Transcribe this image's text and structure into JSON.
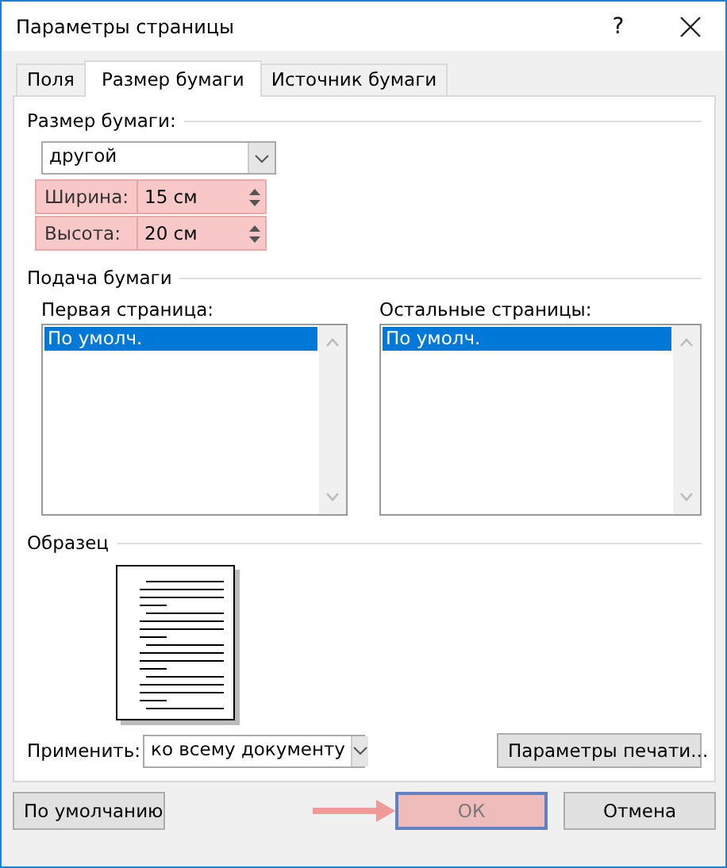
{
  "window": {
    "title": "Параметры страницы",
    "help": "?"
  },
  "tabs": [
    {
      "label": "Поля",
      "selected": false
    },
    {
      "label": "Размер бумаги",
      "selected": true
    },
    {
      "label": "Источник бумаги",
      "selected": false
    }
  ],
  "paper_size": {
    "heading": "Размер бумаги:",
    "dropdown": "другой",
    "fields": [
      {
        "label": "Ширина:",
        "value": "15 см",
        "highlighted": true
      },
      {
        "label": "Высота:",
        "value": "20 см",
        "highlighted": true
      }
    ]
  },
  "paper_source": {
    "heading": "Подача бумаги",
    "lists": [
      {
        "label": "Первая страница:",
        "items": [
          {
            "text": "По умолч.",
            "selected": true
          }
        ]
      },
      {
        "label": "Остальные страницы:",
        "items": [
          {
            "text": "По умолч.",
            "selected": true
          }
        ]
      }
    ]
  },
  "preview": {
    "heading": "Образец"
  },
  "apply": {
    "label": "Применить:",
    "dropdown": "ко всему документу",
    "print_button": "Параметры печати..."
  },
  "buttons": [
    {
      "label": "По умолчанию",
      "highlighted": false
    },
    {
      "label": "ОК",
      "highlighted": true
    },
    {
      "label": "Отмена",
      "highlighted": false
    }
  ]
}
